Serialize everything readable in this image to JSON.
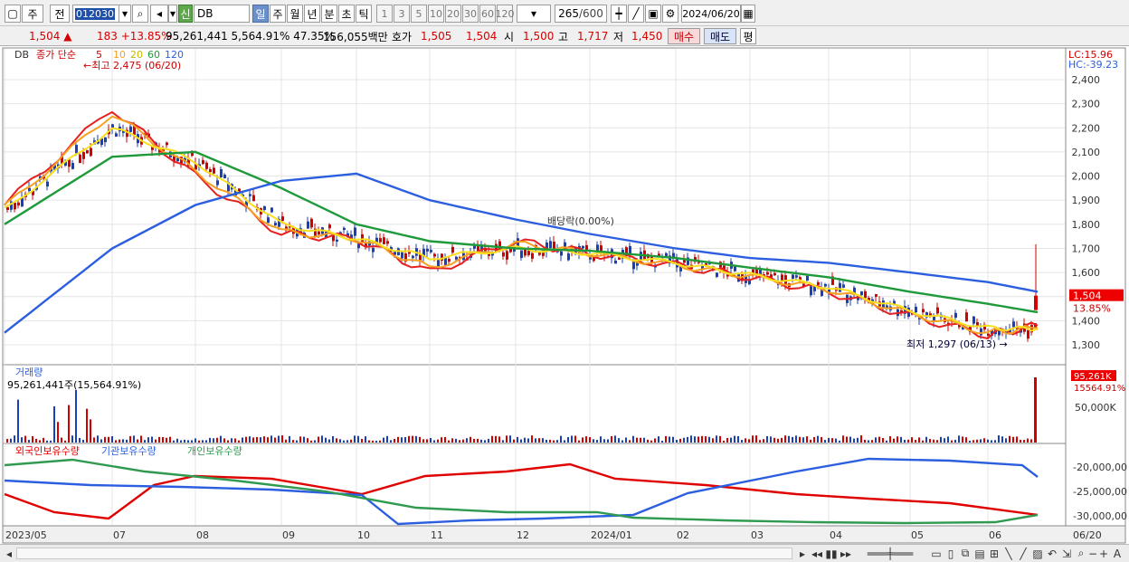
{
  "toolbar": {
    "ju": "주",
    "jeon": "전",
    "stock_code": "012030",
    "sin": "신",
    "stock_name": "DB",
    "periods": [
      "일",
      "주",
      "월",
      "년",
      "분",
      "초",
      "틱"
    ],
    "active_period": "일",
    "intervals": [
      "1",
      "3",
      "5",
      "10",
      "20",
      "30",
      "60",
      "120"
    ],
    "count": "265",
    "count_total": "/600",
    "date": "2024/06/20"
  },
  "quote": {
    "price": "1,504",
    "arrow": "▲",
    "change": "183",
    "change_pct": "+13.85%",
    "volume": "95,261,441",
    "volume_pct": "5,564.91%",
    "turnover": "47.35%",
    "amount": "156,055백만",
    "hoga_label": "호가",
    "ask": "1,505",
    "bid": "1,504",
    "open_label": "시",
    "open": "1,500",
    "high_label": "고",
    "high": "1,717",
    "low_label": "저",
    "low": "1,450",
    "buy": "매수",
    "sell": "매도",
    "eval": "평"
  },
  "price_panel": {
    "db_tag": "DB",
    "legend": [
      "종가 단순",
      "5",
      "10",
      "20",
      "60",
      "120"
    ],
    "max_label": "최고 2,475 (06/20)",
    "min_label": "최저 1,297 (06/13)",
    "dividend_label": "배당락(0.00%)",
    "lc": "LC:15.96",
    "hc": "HC:-39.23",
    "last_price": "1,504",
    "last_pct": "13.85%",
    "y_ticks": [
      "2,400",
      "2,300",
      "2,200",
      "2,100",
      "2,000",
      "1,900",
      "1,800",
      "1,700",
      "1,600",
      "1,500",
      "1,400",
      "1,300"
    ]
  },
  "volume_panel": {
    "title": "거래량",
    "value_label": "95,261,441주(15,564.91%)",
    "badge": "95,261K",
    "badge_pct": "15564.91%",
    "tick": "50,000K"
  },
  "holdings_panel": {
    "legend": [
      "외국인보유수량",
      "기관보유수량",
      "개인보유수량"
    ],
    "ticks": [
      "-20,000,00",
      "-25,000,00",
      "-30,000,00"
    ]
  },
  "x_axis": [
    "2023/05",
    "07",
    "08",
    "09",
    "10",
    "11",
    "12",
    "2024/01",
    "02",
    "03",
    "04",
    "05",
    "06"
  ],
  "x_end": "06/20",
  "colors": {
    "ma5": "#e62020",
    "ma10": "#f5a020",
    "ma20": "#f8e020",
    "ma60": "#1f9a3a",
    "ma120": "#2c5fe0",
    "up": "#d40000",
    "down": "#1a3fb8",
    "foreign": "#e00000",
    "inst": "#2c5fe0",
    "indiv": "#2f9a50"
  },
  "chart_data": {
    "type": "line",
    "x": [
      "2023/05",
      "07",
      "08",
      "09",
      "10",
      "11",
      "12",
      "2024/01",
      "02",
      "03",
      "04",
      "05",
      "06",
      "06/20"
    ],
    "series": [
      {
        "name": "5",
        "values": [
          1880,
          2280,
          2000,
          1760,
          1740,
          1600,
          1730,
          1680,
          1630,
          1580,
          1520,
          1420,
          1340,
          1380
        ]
      },
      {
        "name": "10",
        "values": [
          1870,
          2260,
          2020,
          1770,
          1740,
          1620,
          1720,
          1680,
          1630,
          1585,
          1530,
          1430,
          1350,
          1370
        ]
      },
      {
        "name": "20",
        "values": [
          1860,
          2200,
          2060,
          1800,
          1740,
          1660,
          1700,
          1680,
          1640,
          1590,
          1540,
          1440,
          1370,
          1365
        ]
      },
      {
        "name": "60",
        "values": [
          1800,
          2080,
          2100,
          1950,
          1800,
          1730,
          1700,
          1690,
          1660,
          1620,
          1580,
          1520,
          1470,
          1435
        ]
      },
      {
        "name": "120",
        "values": [
          1350,
          1700,
          1880,
          1980,
          2010,
          1900,
          1820,
          1760,
          1700,
          1660,
          1640,
          1600,
          1560,
          1520
        ]
      }
    ],
    "ylim": [
      1250,
      2450
    ]
  }
}
